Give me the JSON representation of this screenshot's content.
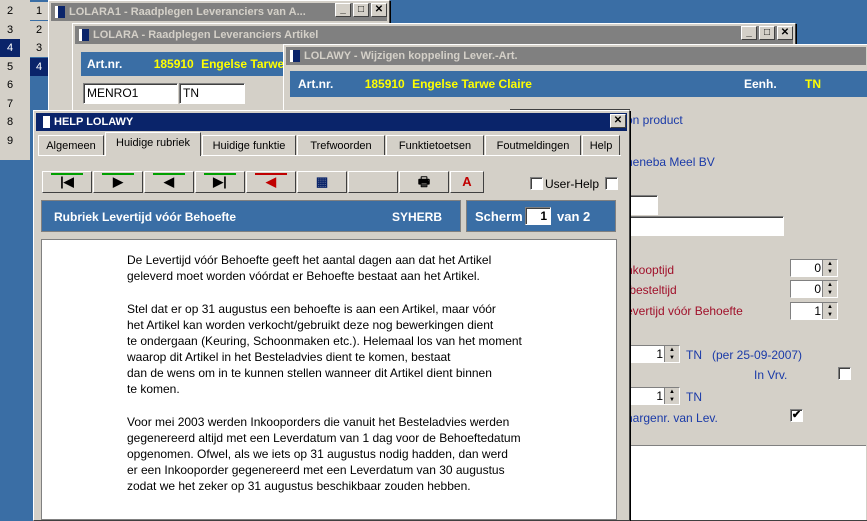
{
  "row_numbers": [
    "2",
    "3",
    "4",
    "5",
    "6",
    "7",
    "8",
    "9"
  ],
  "row_numbers_right": [
    "1",
    "2",
    "3",
    "4"
  ],
  "win1": {
    "title": "LOLARA1 - Raadplegen Leveranciers van A..."
  },
  "win2": {
    "title": "LOLARA - Raadplegen Leveranciers Artikel",
    "artnr_label": "Art.nr.",
    "artnr_value": "185910",
    "artname": "Engelse Tarwe",
    "field1": "MENRO1",
    "field2": "TN"
  },
  "win3": {
    "title": "LOLAWY - Wijzigen koppeling Lever.-Art.",
    "artnr_label": "Art.nr.",
    "artnr_value": "185910",
    "artname": "Engelse Tarwe Claire",
    "eenh_label": "Eenh.",
    "eenh_value": "TN",
    "product_text": "on product",
    "supplier_text": "neneba Meel BV",
    "inkooptijd_label": "nkooptijd",
    "inkooptijd_value": "0",
    "afbesteltijd_label": "fbesteltijd",
    "afbesteltijd_value": "0",
    "levertijd_label": "evertijd vóór Behoefte",
    "levertijd_value": "1",
    "qty1_value": "1",
    "qty1_unit": "TN",
    "qty1_note": "(per 25-09-2007)",
    "invrv_label": "In Vrv.",
    "qty2_value": "1",
    "qty2_unit": "TN",
    "chargenr_label": "hargenr. van Lev.",
    "chargenr_checked": "✔"
  },
  "help": {
    "title": "HELP LOLAWY",
    "close": "✕",
    "tabs": [
      "Algemeen",
      "Huidige rubriek",
      "Huidige funktie",
      "Trefwoorden",
      "Funktietoetsen",
      "Foutmeldingen",
      "Help"
    ],
    "selected_tab": "Huidige rubriek",
    "toolbar": {
      "first": "|◀",
      "next": "▶",
      "prev": "◀",
      "last": "▶|",
      "back": "◀",
      "calc": "▦",
      "print": "🖶",
      "search": "A"
    },
    "user_help_label": "User-Help",
    "rubriek_label": "Rubriek Levertijd vóór Behoefte",
    "rubriek_code": "SYHERB",
    "scherm_label": "Scherm",
    "scherm_value": "1",
    "scherm_van": "van 2",
    "paragraphs": [
      [
        "De Levertijd vóór Behoefte geeft het aantal dagen aan dat het Artikel",
        "geleverd moet worden vóórdat er Behoefte bestaat aan het Artikel."
      ],
      [
        "Stel dat er op 31 augustus een behoefte is aan een Artikel, maar vóór",
        "het Artikel kan worden verkocht/gebruikt deze nog bewerkingen dient",
        "te ondergaan (Keuring, Schoonmaken etc.). Helemaal los van het moment",
        "waarop dit Artikel in het Besteladvies dient te komen, bestaat",
        "dan de wens om in te kunnen stellen wanneer dit Artikel dient binnen",
        "te komen."
      ],
      [
        "Voor mei 2003 werden Inkooporders die vanuit het Besteladvies werden",
        "gegenereerd altijd met een Leverdatum van 1 dag voor de Behoeftedatum",
        "opgenomen. Ofwel, als we iets op 31 augustus nodig hadden, dan werd",
        "er een Inkooporder gegenereerd met een Leverdatum van 30 augustus",
        "zodat we het zeker op 31 augustus beschikbaar zouden hebben."
      ]
    ]
  }
}
